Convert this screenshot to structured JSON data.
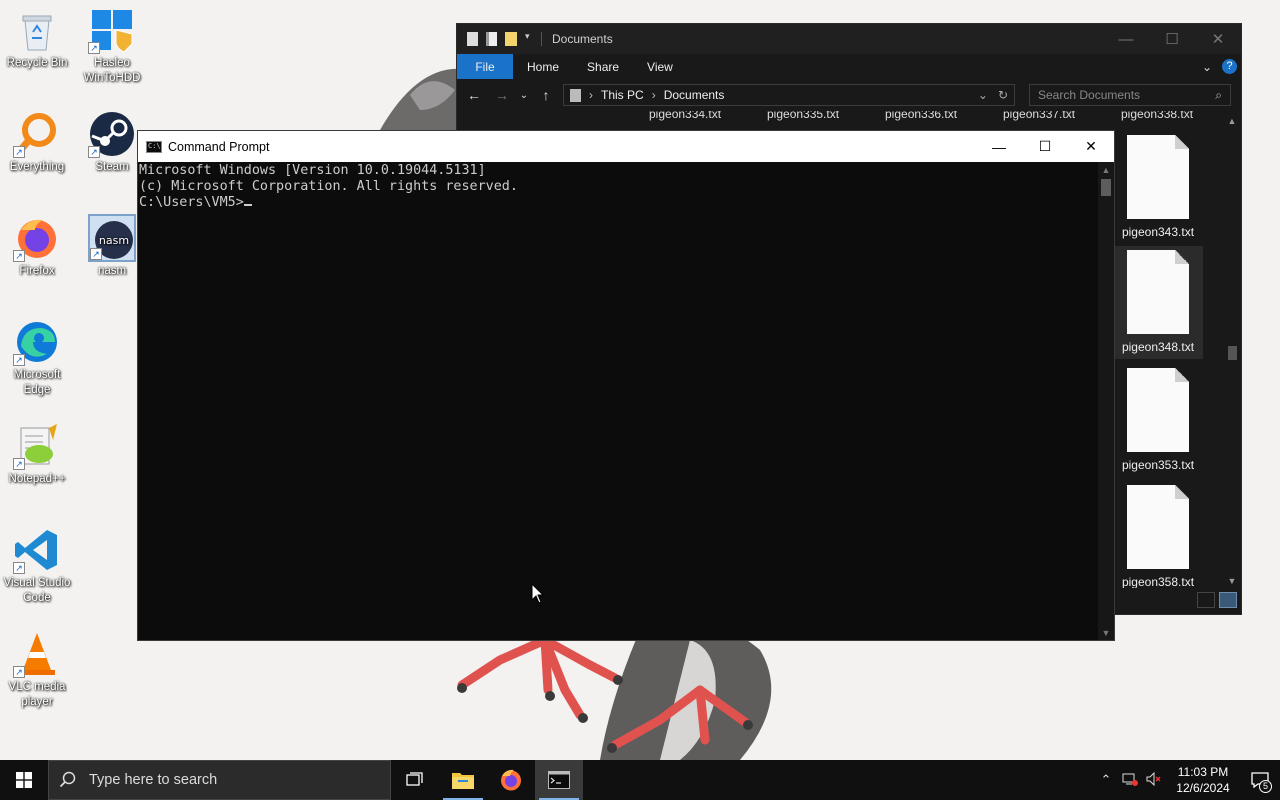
{
  "desktop": {
    "icons": [
      {
        "label": "Recycle Bin",
        "icon": "recycle-bin-icon"
      },
      {
        "label": "Hasleo WinToHDD",
        "icon": "hasleo-icon"
      },
      {
        "label": "Everything",
        "icon": "everything-search-icon"
      },
      {
        "label": "Steam",
        "icon": "steam-icon"
      },
      {
        "label": "Firefox",
        "icon": "firefox-icon"
      },
      {
        "label": "nasm",
        "icon": "nasm-icon"
      },
      {
        "label": "Microsoft Edge",
        "icon": "edge-icon"
      },
      {
        "label": "Notepad++",
        "icon": "notepadpp-icon"
      },
      {
        "label": "Visual Studio Code",
        "icon": "vscode-icon"
      },
      {
        "label": "VLC media player",
        "icon": "vlc-icon"
      }
    ],
    "nasm_text": "nasm"
  },
  "explorer": {
    "title": "Documents",
    "ribbon_tabs": [
      "File",
      "Home",
      "Share",
      "View"
    ],
    "breadcrumb": [
      "This PC",
      "Documents"
    ],
    "search_placeholder": "Search Documents",
    "partial_files": [
      "pigeon334.txt",
      "pigeon335.txt",
      "pigeon336.txt",
      "pigeon337.txt",
      "pigeon338.txt"
    ],
    "files": [
      {
        "name": "pigeon343.txt"
      },
      {
        "name": "pigeon348.txt"
      },
      {
        "name": "pigeon353.txt"
      },
      {
        "name": "pigeon358.txt"
      }
    ]
  },
  "cmd": {
    "title": "Command Prompt",
    "lines": [
      "Microsoft Windows [Version 10.0.19044.5131]",
      "(c) Microsoft Corporation. All rights reserved.",
      ""
    ],
    "prompt": "C:\\Users\\VM5>"
  },
  "taskbar": {
    "search_placeholder": "Type here to search",
    "apps": [
      "task-view-icon",
      "file-explorer-icon",
      "firefox-icon",
      "command-prompt-icon"
    ],
    "clock_time": "11:03 PM",
    "clock_date": "12/6/2024",
    "notification_count": "5"
  },
  "colors": {
    "accent": "#1a73c9",
    "console_bg": "#0c0c0c",
    "console_text": "#cccccc",
    "taskbar_bg": "#101010"
  }
}
